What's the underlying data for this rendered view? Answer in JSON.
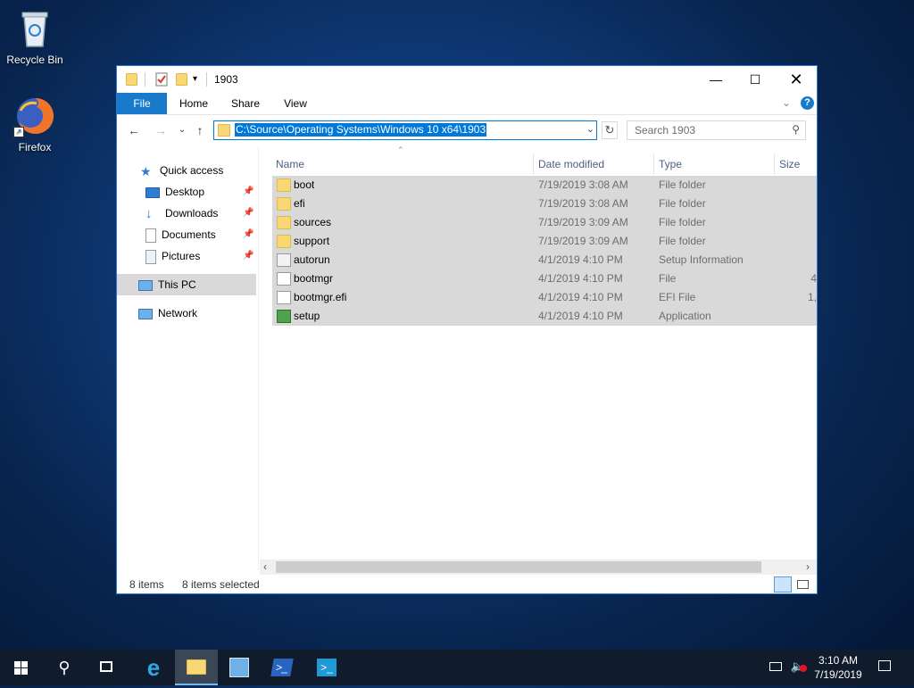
{
  "desktop": {
    "icons": [
      {
        "label": "Recycle Bin"
      },
      {
        "label": "Firefox"
      }
    ]
  },
  "window": {
    "title": "1903",
    "ribbon_tabs": [
      "File",
      "Home",
      "Share",
      "View"
    ],
    "address": "C:\\Source\\Operating Systems\\Windows 10 x64\\1903",
    "search_placeholder": "Search 1903",
    "nav": {
      "quick_access": "Quick access",
      "items": [
        "Desktop",
        "Downloads",
        "Documents",
        "Pictures"
      ],
      "this_pc": "This PC",
      "network": "Network"
    },
    "columns": [
      "Name",
      "Date modified",
      "Type",
      "Size"
    ],
    "files": [
      {
        "name": "boot",
        "date": "7/19/2019 3:08 AM",
        "type": "File folder",
        "size": "",
        "icon": "folder-icon"
      },
      {
        "name": "efi",
        "date": "7/19/2019 3:08 AM",
        "type": "File folder",
        "size": "",
        "icon": "folder-icon"
      },
      {
        "name": "sources",
        "date": "7/19/2019 3:09 AM",
        "type": "File folder",
        "size": "",
        "icon": "folder-icon"
      },
      {
        "name": "support",
        "date": "7/19/2019 3:09 AM",
        "type": "File folder",
        "size": "",
        "icon": "folder-icon"
      },
      {
        "name": "autorun",
        "date": "4/1/2019 4:10 PM",
        "type": "Setup Information",
        "size": "",
        "icon": "setup-info-icon"
      },
      {
        "name": "bootmgr",
        "date": "4/1/2019 4:10 PM",
        "type": "File",
        "size": "4",
        "icon": "file-icon"
      },
      {
        "name": "bootmgr.efi",
        "date": "4/1/2019 4:10 PM",
        "type": "EFI File",
        "size": "1,",
        "icon": "file-icon"
      },
      {
        "name": "setup",
        "date": "4/1/2019 4:10 PM",
        "type": "Application",
        "size": "",
        "icon": "setup-app-icon"
      }
    ],
    "status": {
      "count": "8 items",
      "selected": "8 items selected"
    }
  },
  "taskbar": {
    "time": "3:10 AM",
    "date": "7/19/2019"
  },
  "colors": {
    "accent": "#0078d7",
    "selection": "#d9d9d9",
    "folder": "#f8d775"
  }
}
